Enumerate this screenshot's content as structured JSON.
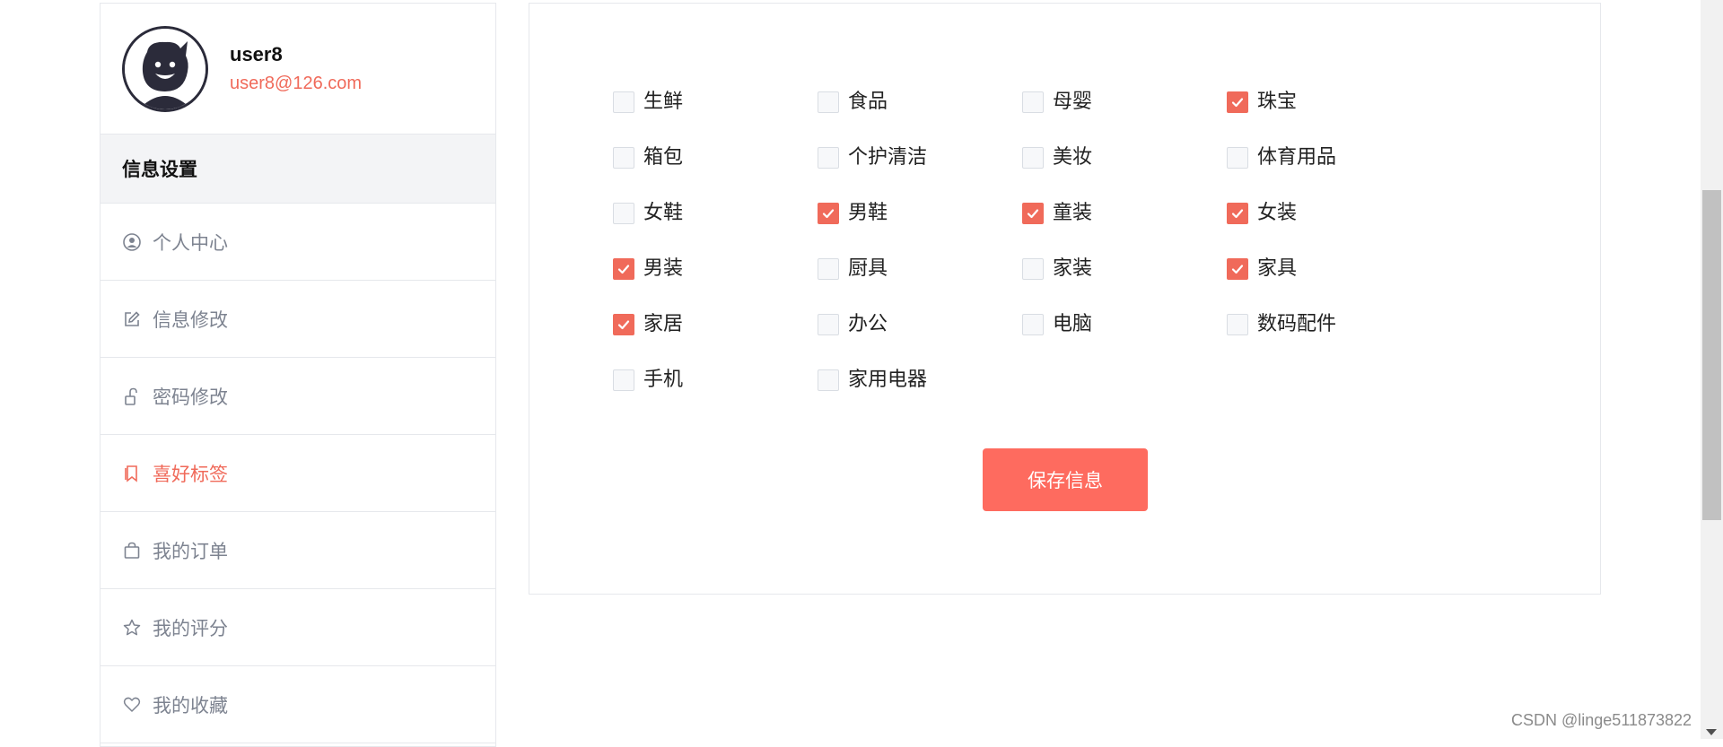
{
  "profile": {
    "username": "user8",
    "email": "user8@126.com"
  },
  "sidebar": {
    "section_title": "信息设置",
    "items": [
      {
        "label": "个人中心",
        "icon": "user-circle-icon",
        "active": false
      },
      {
        "label": "信息修改",
        "icon": "edit-icon",
        "active": false
      },
      {
        "label": "密码修改",
        "icon": "unlock-icon",
        "active": false
      },
      {
        "label": "喜好标签",
        "icon": "bookmark-icon",
        "active": true
      },
      {
        "label": "我的订单",
        "icon": "shopping-bag-icon",
        "active": false
      },
      {
        "label": "我的评分",
        "icon": "star-icon",
        "active": false
      },
      {
        "label": "我的收藏",
        "icon": "heart-icon",
        "active": false
      }
    ]
  },
  "tags": [
    {
      "label": "生鲜",
      "checked": false
    },
    {
      "label": "食品",
      "checked": false
    },
    {
      "label": "母婴",
      "checked": false
    },
    {
      "label": "珠宝",
      "checked": true
    },
    {
      "label": "箱包",
      "checked": false
    },
    {
      "label": "个护清洁",
      "checked": false
    },
    {
      "label": "美妆",
      "checked": false
    },
    {
      "label": "体育用品",
      "checked": false
    },
    {
      "label": "女鞋",
      "checked": false
    },
    {
      "label": "男鞋",
      "checked": true
    },
    {
      "label": "童装",
      "checked": true
    },
    {
      "label": "女装",
      "checked": true
    },
    {
      "label": "男装",
      "checked": true
    },
    {
      "label": "厨具",
      "checked": false
    },
    {
      "label": "家装",
      "checked": false
    },
    {
      "label": "家具",
      "checked": true
    },
    {
      "label": "家居",
      "checked": true
    },
    {
      "label": "办公",
      "checked": false
    },
    {
      "label": "电脑",
      "checked": false
    },
    {
      "label": "数码配件",
      "checked": false
    },
    {
      "label": "手机",
      "checked": false
    },
    {
      "label": "家用电器",
      "checked": false
    }
  ],
  "save_button": "保存信息",
  "watermark": "CSDN @linge511873822",
  "colors": {
    "accent": "#f06a5a",
    "button": "#fe6b5f",
    "muted_text": "#7d8390"
  }
}
